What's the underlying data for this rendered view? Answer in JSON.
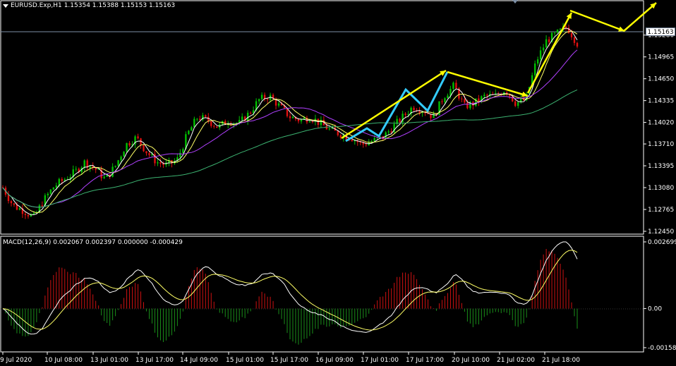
{
  "window": {
    "title": "EURUSD.Exp,H1",
    "ohlc": "1.15354 1.15388 1.15153 1.15163"
  },
  "price_tag": "1.15163",
  "macd": {
    "title": "MACD(12,26,9) 0.002067 0.002397 0.000000 -0.000429"
  },
  "colors": {
    "background": "#000000",
    "bull_candle": "#00c000",
    "bear_candle": "#e01010",
    "ma_fast": "#ffffff",
    "ma_mid": "#ffff66",
    "ma_slow": "#b040ff",
    "ma_long": "#3cb371",
    "arrow_yellow": "#ffff00",
    "arrow_cyan": "#33ccff",
    "macd_line": "#ffffff",
    "signal_line": "#ffff66",
    "hist_pos": "#cc1111",
    "hist_neg": "#1a8f1a"
  },
  "chart_data": [
    {
      "type": "candlestick",
      "title": "EURUSD.Exp,H1",
      "x_ticks": [
        "9 Jul 2020",
        "10 Jul 08:00",
        "13 Jul 01:00",
        "13 Jul 17:00",
        "14 Jul 09:00",
        "15 Jul 01:00",
        "15 Jul 17:00",
        "16 Jul 09:00",
        "17 Jul 01:00",
        "17 Jul 17:00",
        "20 Jul 10:00",
        "21 Jul 02:00",
        "21 Jul 18:00"
      ],
      "y_ticks": [
        "1.15280",
        "1.14965",
        "1.14650",
        "1.14335",
        "1.14020",
        "1.13710",
        "1.13395",
        "1.13080",
        "1.12765",
        "1.12450"
      ],
      "ylim": [
        1.1245,
        1.1545
      ],
      "close_path": [
        1.1308,
        1.1282,
        1.1275,
        1.1265,
        1.129,
        1.131,
        1.132,
        1.133,
        1.1345,
        1.1335,
        1.132,
        1.134,
        1.137,
        1.138,
        1.136,
        1.1345,
        1.134,
        1.1348,
        1.1385,
        1.141,
        1.1405,
        1.1395,
        1.1405,
        1.14,
        1.1415,
        1.1435,
        1.144,
        1.1425,
        1.141,
        1.1405,
        1.141,
        1.14,
        1.139,
        1.1385,
        1.138,
        1.137,
        1.1375,
        1.138,
        1.1395,
        1.141,
        1.1425,
        1.142,
        1.141,
        1.144,
        1.1455,
        1.1425,
        1.143,
        1.144,
        1.144,
        1.145,
        1.143,
        1.1435,
        1.149,
        1.152,
        1.153,
        1.154,
        1.1516
      ],
      "annotations": [
        "yellow trend arrows",
        "cyan zigzag"
      ]
    },
    {
      "type": "bar",
      "title": "MACD(12,26,9) 0.002067 0.002397 0.000000 -0.000429",
      "y_ticks": [
        "0.002699",
        "0.00",
        "-0.001582"
      ],
      "ylim": [
        -0.001582,
        0.002699
      ]
    }
  ]
}
